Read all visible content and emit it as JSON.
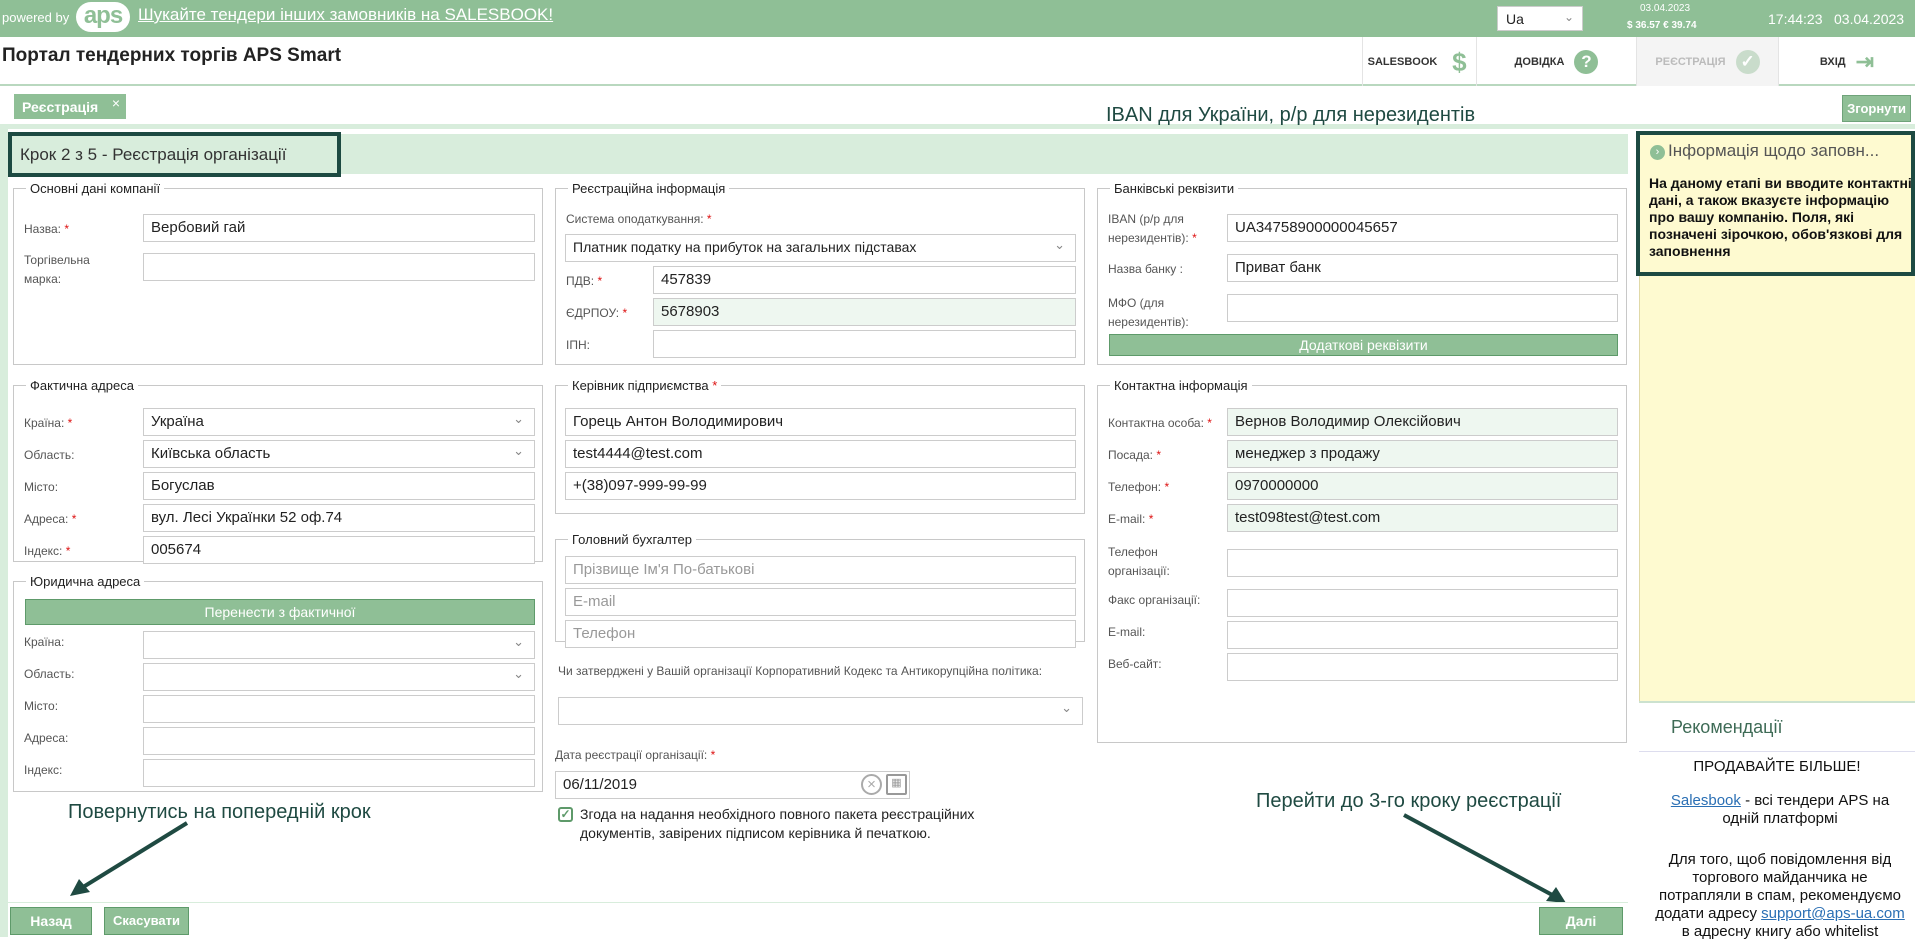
{
  "topbar": {
    "powered": "powered by",
    "logo": "aps",
    "promo": "Шукайте тендери інших замовників на SALESBOOK!",
    "lang": "Ua",
    "rates_date": "03.04.2023",
    "rates": "$ 36.57  € 39.74",
    "time": "17:44:23",
    "date": "03.04.2023"
  },
  "header": {
    "title": "Портал тендерних торгів APS Smart",
    "salesbook": "SALESBOOK",
    "help": "ДОВІДКА",
    "register": "РЕЄСТРАЦІЯ",
    "login": "ВХІД"
  },
  "tabs": {
    "registration": "Реєстрація",
    "close": "×",
    "collapse": "Згорнути"
  },
  "annotations": {
    "iban": "IBAN для України, р/р для нерезидентів",
    "back": "Повернутись на попередній крок",
    "next": "Перейти до 3-го кроку реєстрації"
  },
  "step": "Крок 2 з 5 - Реєстрація організації",
  "basic": {
    "legend": "Основні дані компанії",
    "name_label": "Назва:",
    "name": "Вербовий гай",
    "brand_label": "Торгівельна марка:",
    "brand": ""
  },
  "actual": {
    "legend": "Фактична адреса",
    "country_label": "Країна:",
    "country": "Україна",
    "region_label": "Область:",
    "region": "Київська область",
    "city_label": "Місто:",
    "city": "Богуслав",
    "address_label": "Адреса:",
    "address": "вул. Лесі Українки 52 оф.74",
    "index_label": "Індекс:",
    "index": "005674"
  },
  "legal": {
    "legend": "Юридична адреса",
    "copy_btn": "Перенести з фактичної",
    "country_label": "Країна:",
    "region_label": "Область:",
    "city_label": "Місто:",
    "address_label": "Адреса:",
    "index_label": "Індекс:"
  },
  "reg": {
    "legend": "Реєстраційна інформація",
    "tax_label": "Система оподаткування:",
    "tax": "Платник податку на прибуток на загальних підставах",
    "vat_label": "ПДВ:",
    "vat": "457839",
    "edrpou_label": "ЄДРПОУ:",
    "edrpou": "5678903",
    "ipn_label": "ІПН:",
    "ipn": ""
  },
  "director": {
    "legend": "Керівник підприємства",
    "name": "Горець Антон Володимирович",
    "email": "test4444@test.com",
    "phone": "+(38)097-999-99-99"
  },
  "accountant": {
    "legend": "Головний бухгалтер",
    "name_ph": "Прізвище Ім'я По-батькові",
    "email_ph": "E-mail",
    "phone_ph": "Телефон"
  },
  "codex": {
    "label": "Чи затверджені у Вашій організації Корпоративний Кодекс та Антикорупційна політика:",
    "value": ""
  },
  "regdate": {
    "label": "Дата реєстрації організації:",
    "value": "06/11/2019"
  },
  "consent": {
    "line1": "Згода на надання необхідного повного пакета реєстраційних",
    "line2": "документів, завірених підписом керівника й печаткою.",
    "checked": true
  },
  "bank": {
    "legend": "Банківські реквізити",
    "iban_label1": "IBAN (р/р для",
    "iban_label2": "нерезидентів):",
    "iban": "UA34758900000045657",
    "bankname_label": "Назва банку :",
    "bankname": "Приват банк",
    "mfo_label1": "МФО (для",
    "mfo_label2": "нерезидентів):",
    "mfo": "",
    "extra_btn": "Додаткові реквізити"
  },
  "contact": {
    "legend": "Контактна інформація",
    "person_label": "Контактна особа:",
    "person": "Вернов Володимир Олексійович",
    "position_label": "Посада:",
    "position": "менеджер з продажу",
    "phone_label": "Телефон:",
    "phone": "0970000000",
    "email_label": "E-mail:",
    "email": "test098test@test.com",
    "orgphone_label1": "Телефон",
    "orgphone_label2": "організації:",
    "fax_label": "Факс організації:",
    "orgemail_label": "E-mail:",
    "site_label": "Веб-сайт:"
  },
  "footer": {
    "back": "Назад",
    "cancel": "Скасувати",
    "next": "Далі"
  },
  "info": {
    "title": "Інформація щодо заповн...",
    "text": "На даному етапі ви вводите контактні дані, а також вказуєте інформацію про вашу компанію. Поля, які позначені зірочкою, обов'язкові для заповнення"
  },
  "recommend": {
    "title": "Рекомендації",
    "p1": "ПРОДАВАЙТЕ БІЛЬШЕ!",
    "p2_link": "Salesbook",
    "p2_text": " - всі тендери APS на одній платформі",
    "p3_a": "Для того, щоб повідомлення від торгового майданчика не потрапляли в спам, рекомендуємо додати адресу ",
    "p3_link": "support@aps-ua.com",
    "p3_b": " в адресну книгу або whitelist"
  },
  "icons": {
    "salesbook": "dollar-icon",
    "help": "question-icon",
    "register": "check-icon",
    "login": "login-arrow-icon"
  },
  "colors": {
    "accent": "#8fbf96",
    "dark_frame": "#1d4a42",
    "info_bg": "#fefad0",
    "required": "#d11111"
  }
}
